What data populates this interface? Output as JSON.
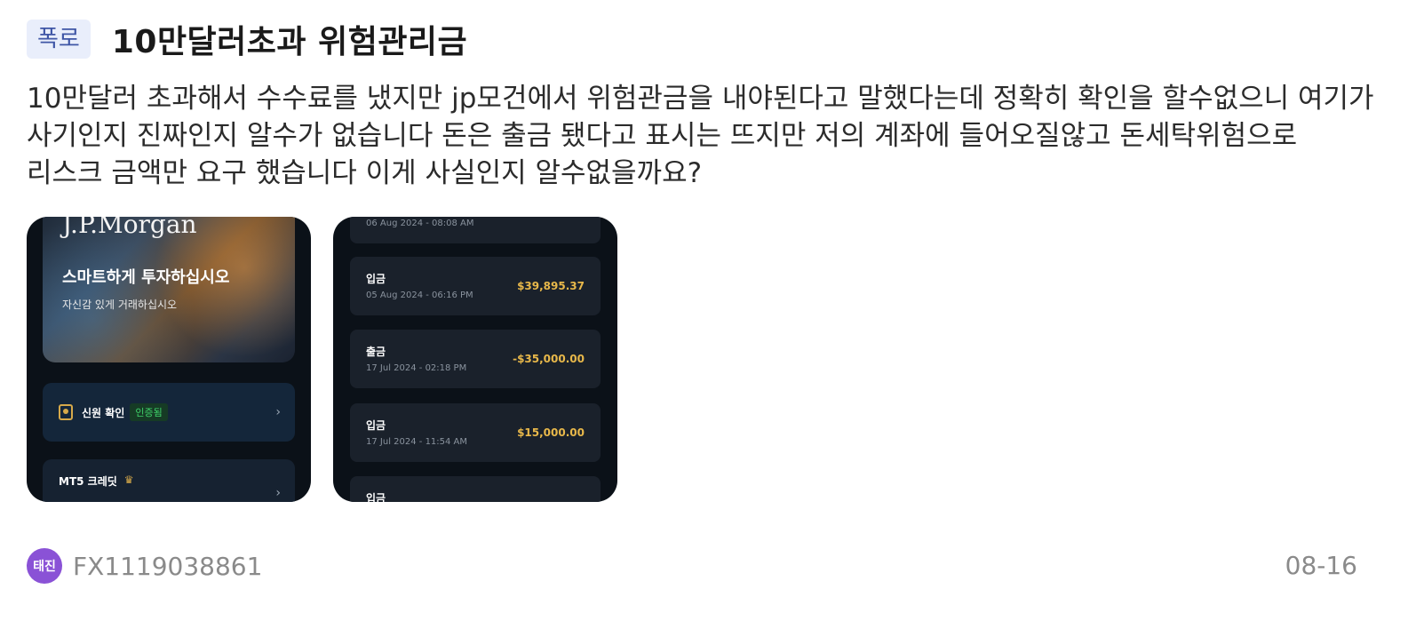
{
  "post": {
    "tag": "폭로",
    "title": "10만달러초과 위험관리금",
    "body": "10만달러 초과해서 수수료를 냈지만 jp모건에서 위험관금을 내야된다고 말했다는데 정확히 확인을 할수없으니 여기가 사기인지 진짜인지 알수가 없습니다 돈은 출금 됐다고 표시는 뜨지만 저의 계좌에 들어오질않고 돈세탁위험으로 리스크 금액만 요구 했습니다 이게 사실인지 알수없을까요?"
  },
  "thumb1": {
    "brand": "J.P.Morgan",
    "headline": "스마트하게 투자하십시오",
    "subline": "자신감 있게 거래하십시오",
    "identity_label": "신원 확인",
    "identity_status": "인증됨",
    "credit_label": "MT5 크레딧",
    "chevron": "›"
  },
  "thumb2": {
    "transactions": [
      {
        "type": "",
        "date": "06 Aug 2024 - 08:08 AM",
        "amount": ""
      },
      {
        "type": "입금",
        "date": "05 Aug 2024 - 06:16 PM",
        "amount": "$39,895.37"
      },
      {
        "type": "출금",
        "date": "17 Jul 2024 - 02:18 PM",
        "amount": "-$35,000.00"
      },
      {
        "type": "입금",
        "date": "17 Jul 2024 - 11:54 AM",
        "amount": "$15,000.00"
      },
      {
        "type": "입금",
        "date": "",
        "amount": ""
      }
    ]
  },
  "footer": {
    "avatar_text": "태진",
    "username": "FX1119038861",
    "date": "08-16"
  },
  "colors": {
    "tag_bg": "#e9eefb",
    "tag_text": "#3f56a6",
    "avatar": "#8a52d6",
    "amount": "#e8b84a",
    "verified": "#3fd46a"
  }
}
